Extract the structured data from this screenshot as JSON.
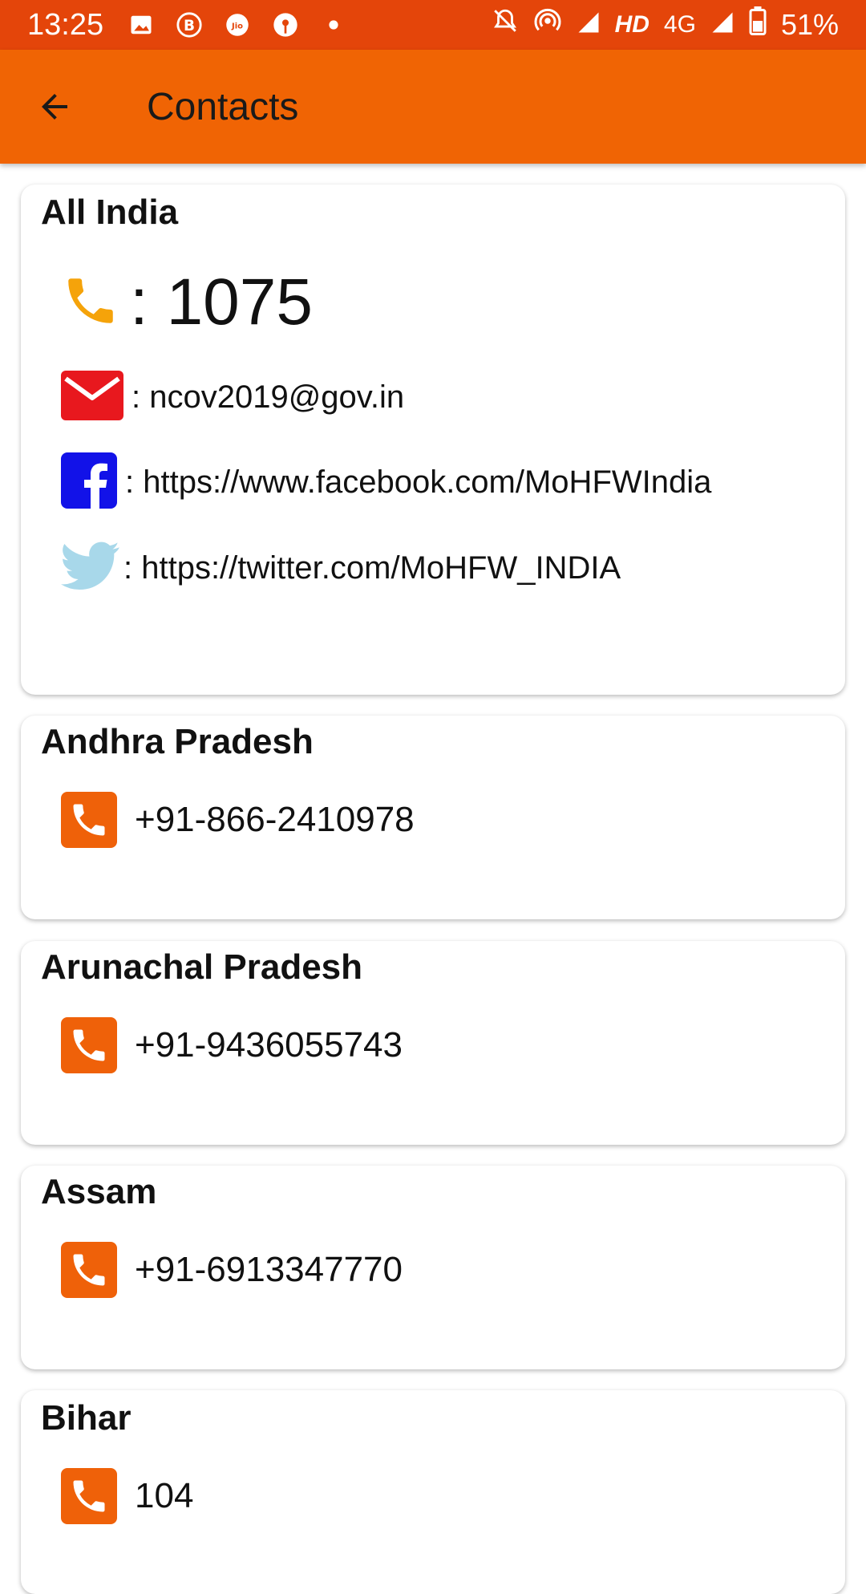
{
  "status_bar": {
    "time": "13:25",
    "network_label": "HD",
    "network_type": "4G",
    "battery": "51%"
  },
  "app_bar": {
    "title": "Contacts"
  },
  "all_india": {
    "title": "All India",
    "phone": ": 1075",
    "email": ": ncov2019@gov.in",
    "facebook": ": https://www.facebook.com/MoHFWIndia",
    "twitter": ": https://twitter.com/MoHFW_INDIA"
  },
  "states": [
    {
      "name": "Andhra Pradesh",
      "phone": "+91-866-2410978"
    },
    {
      "name": "Arunachal Pradesh",
      "phone": "+91-9436055743"
    },
    {
      "name": "Assam",
      "phone": "+91-6913347770"
    },
    {
      "name": "Bihar",
      "phone": "104"
    }
  ],
  "colors": {
    "status_bar": "#e4450a",
    "app_bar": "#f06404",
    "phone_tile": "#ef6109",
    "email_icon": "#e8181e",
    "facebook_icon": "#1212e8",
    "twitter_icon": "#a8d8ea",
    "phone_handset": "#f5a30a"
  }
}
